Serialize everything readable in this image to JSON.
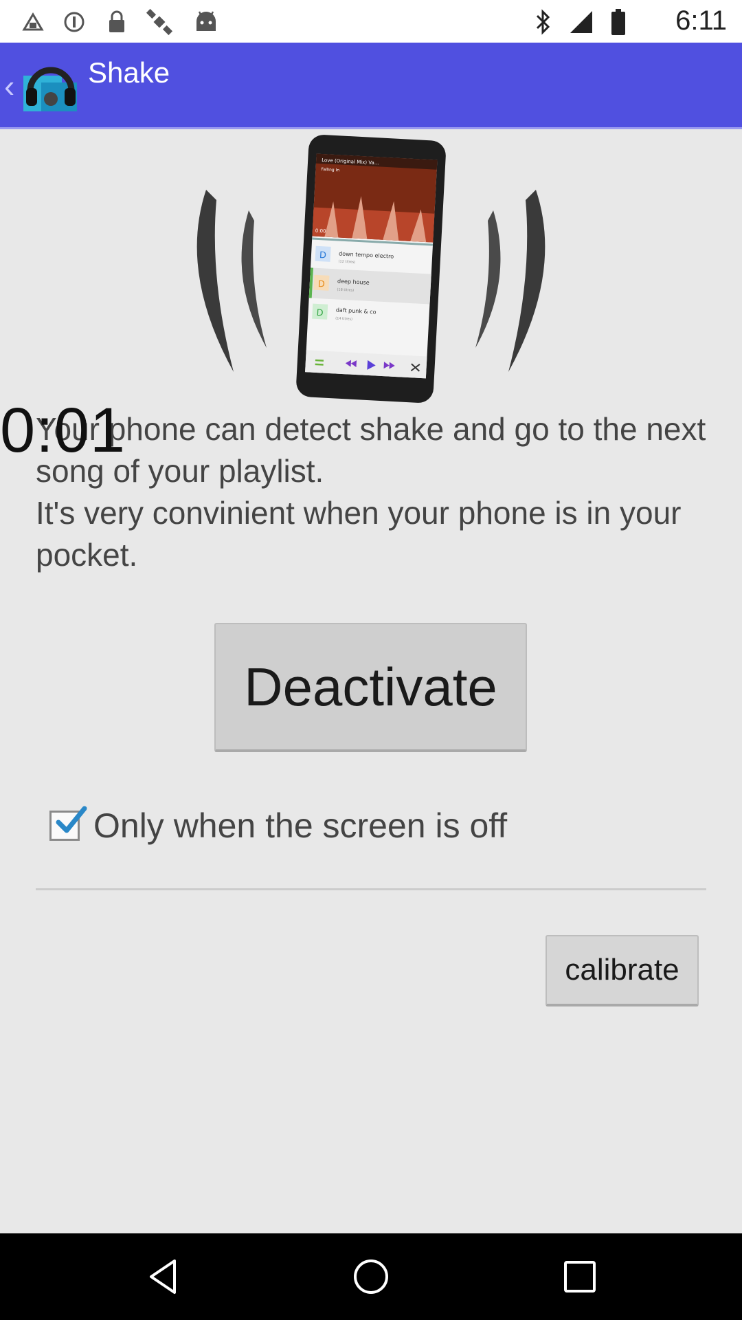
{
  "status_bar": {
    "time": "6:11",
    "icons": [
      "notification-icon",
      "data-saver-icon",
      "lock-icon",
      "satellite-icon",
      "android-icon",
      "bluetooth-icon",
      "signal-icon",
      "battery-icon"
    ]
  },
  "app_bar": {
    "title": "Shake",
    "up_icon": "chevron-left-icon",
    "app_icon": "headphones-app-icon",
    "color": "#5050e0"
  },
  "illustration": {
    "phone_screen": {
      "track_title": "Love (Original Mix) Va...",
      "track_sub": "Falling In",
      "time": "0:00",
      "playlists": [
        {
          "letter": "D",
          "name": "down tempo electro",
          "count": "(12 titres)",
          "color": "#2a7ad8"
        },
        {
          "letter": "D",
          "name": "deep house",
          "count": "(18 titres)",
          "color": "#e88b1a"
        },
        {
          "letter": "D",
          "name": "daft punk & co",
          "count": "(14 titres)",
          "color": "#3aa84a"
        }
      ]
    }
  },
  "timer": "0:01",
  "description": {
    "line1": "Your phone can detect shake and go to the next song of your playlist.",
    "line2": "It's very convinient when your phone is in your pocket."
  },
  "deactivate_button": {
    "label": "Deactivate"
  },
  "screen_off_option": {
    "label": "Only when the screen is off",
    "checked": true
  },
  "calibrate_button": {
    "label": "calibrate"
  },
  "nav_bar": {
    "back": "back-icon",
    "home": "home-icon",
    "recents": "recents-icon"
  }
}
